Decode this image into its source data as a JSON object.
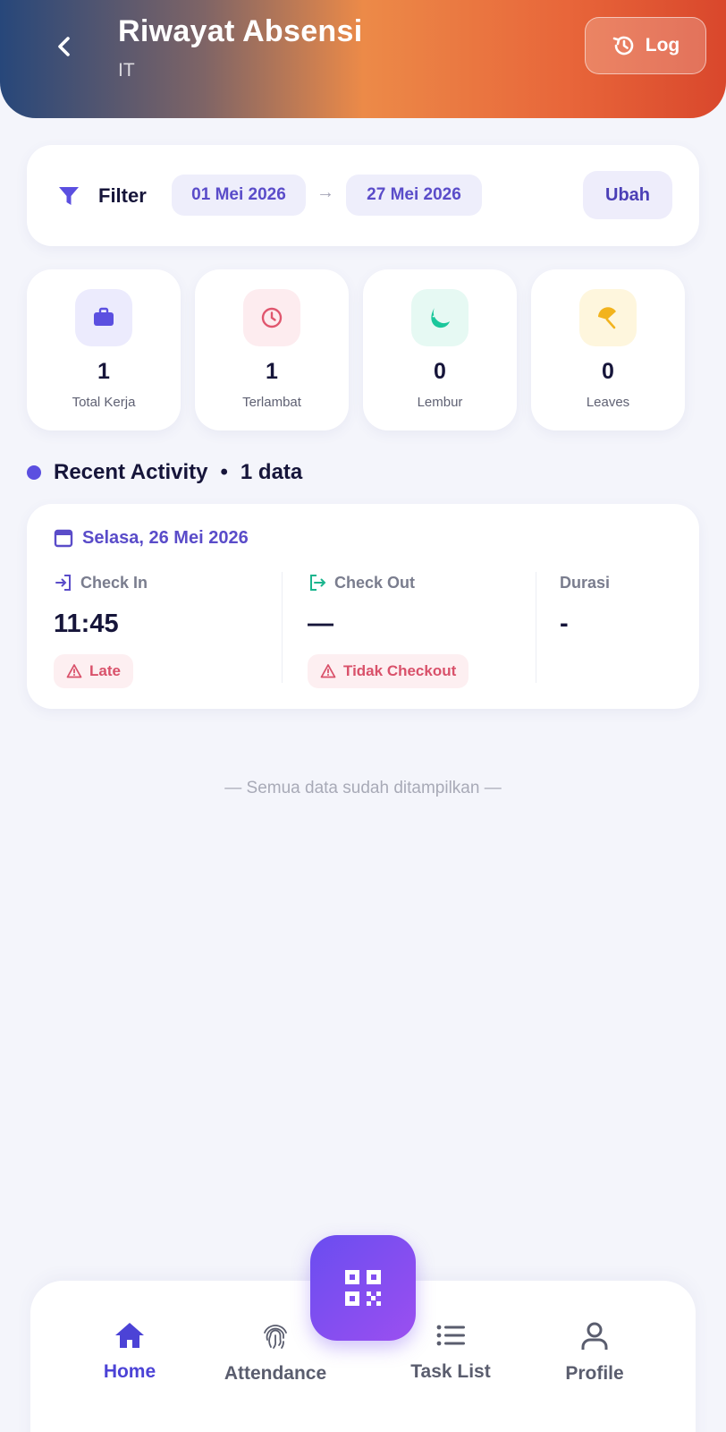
{
  "header": {
    "title": "Riwayat Absensi",
    "subtitle": "IT",
    "log_label": "Log"
  },
  "filter": {
    "label": "Filter",
    "start_date": "01 Mei 2026",
    "arrow": "→",
    "end_date": "27 Mei 2026",
    "change_label": "Ubah"
  },
  "stats": [
    {
      "value": "1",
      "label": "Total Kerja",
      "icon": "briefcase-icon",
      "color": "#5b4fe0",
      "bg": "#ecebfd"
    },
    {
      "value": "1",
      "label": "Terlambat",
      "icon": "clock-icon",
      "color": "#e0566e",
      "bg": "#fdecef"
    },
    {
      "value": "0",
      "label": "Lembur",
      "icon": "moon-icon",
      "color": "#1bc79b",
      "bg": "#e6f9f3"
    },
    {
      "value": "0",
      "label": "Leaves",
      "icon": "umbrella-icon",
      "color": "#f2b31d",
      "bg": "#fef6dd"
    }
  ],
  "recent": {
    "title": "Recent Activity",
    "separator": "•",
    "count": "1 data"
  },
  "activity": {
    "date": "Selasa, 26 Mei 2026",
    "check_in_label": "Check In",
    "check_in_value": "11:45",
    "check_in_badge": "Late",
    "check_out_label": "Check Out",
    "check_out_value": "—",
    "check_out_badge": "Tidak Checkout",
    "duration_label": "Durasi",
    "duration_value": "-"
  },
  "footer_note": "— Semua data sudah ditampilkan —",
  "nav": {
    "items": [
      {
        "label": "Home",
        "icon": "home-icon",
        "active": true
      },
      {
        "label": "Attendance",
        "icon": "fingerprint-icon",
        "active": false
      },
      {
        "label": "Task List",
        "icon": "list-icon",
        "active": false
      },
      {
        "label": "Profile",
        "icon": "user-icon",
        "active": false
      }
    ],
    "fab_icon": "qr-code-icon"
  }
}
